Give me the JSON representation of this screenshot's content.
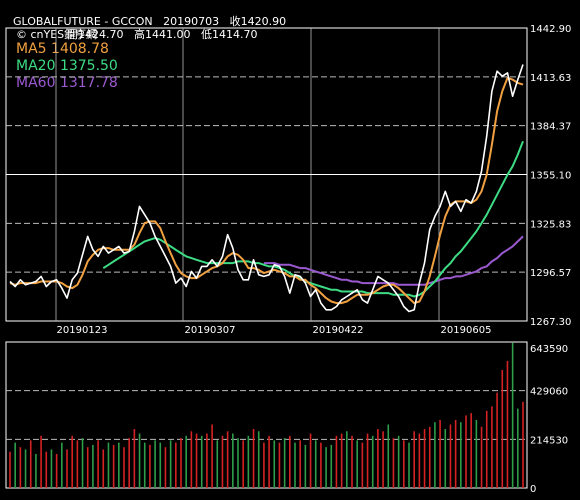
{
  "header": {
    "symbol": "GLOBALFUTURE - GCCON",
    "date": "20190703",
    "close_label": "收",
    "close": "1420.90",
    "open_label": "開",
    "open": "1424.70",
    "high_label": "高",
    "high": "1441.00",
    "low_label": "低",
    "low": "1414.70"
  },
  "watermark": "© cnYES鉅亨網",
  "legend": [
    {
      "name": "MA5",
      "value": "1408.78",
      "color": "#f0a040"
    },
    {
      "name": "MA20",
      "value": "1375.50",
      "color": "#3ddc84"
    },
    {
      "name": "MA60",
      "value": "1317.78",
      "color": "#9b59d0"
    }
  ],
  "colors": {
    "background": "#000000",
    "frame": "#ffffff",
    "grid": "#bbbbbb",
    "price": "#ffffff",
    "vol_up": "#d62222",
    "vol_down": "#2e9e4a"
  },
  "chart_data": [
    {
      "type": "line",
      "title": "",
      "x_tick_labels": [
        "20190123",
        "20190307",
        "20190422",
        "20190605"
      ],
      "y_tick_labels": [
        "1442.90",
        "1413.63",
        "1384.37",
        "1355.10",
        "1325.83",
        "1296.57",
        "1267.30"
      ],
      "ylim": [
        1267.3,
        1442.9
      ],
      "series": [
        {
          "name": "price",
          "values": [
            1291,
            1288,
            1292,
            1289,
            1290,
            1291,
            1294,
            1288,
            1291,
            1292,
            1287,
            1281,
            1292,
            1296,
            1307,
            1318,
            1310,
            1306,
            1312,
            1308,
            1310,
            1312,
            1308,
            1309,
            1321,
            1336,
            1331,
            1326,
            1318,
            1312,
            1306,
            1300,
            1290,
            1293,
            1288,
            1297,
            1293,
            1300,
            1300,
            1304,
            1300,
            1306,
            1319,
            1311,
            1298,
            1292,
            1292,
            1304,
            1295,
            1294,
            1295,
            1301,
            1300,
            1294,
            1284,
            1295,
            1294,
            1290,
            1282,
            1286,
            1278,
            1274,
            1274,
            1276,
            1280,
            1282,
            1284,
            1286,
            1280,
            1278,
            1286,
            1294,
            1292,
            1290,
            1286,
            1282,
            1276,
            1273,
            1274,
            1290,
            1302,
            1322,
            1330,
            1336,
            1345,
            1336,
            1339,
            1333,
            1340,
            1338,
            1345,
            1357,
            1378,
            1405,
            1417,
            1414,
            1416,
            1402,
            1412,
            1421
          ]
        },
        {
          "name": "MA5",
          "values": [
            1290,
            1289,
            1290,
            1290,
            1290,
            1290,
            1291,
            1291,
            1291,
            1291,
            1290,
            1288,
            1287,
            1289,
            1295,
            1303,
            1307,
            1310,
            1311,
            1311,
            1310,
            1310,
            1310,
            1310,
            1313,
            1320,
            1326,
            1327,
            1327,
            1323,
            1315,
            1308,
            1301,
            1296,
            1294,
            1293,
            1293,
            1295,
            1297,
            1299,
            1300,
            1302,
            1306,
            1308,
            1307,
            1304,
            1299,
            1299,
            1298,
            1296,
            1297,
            1298,
            1297,
            1296,
            1294,
            1294,
            1292,
            1292,
            1289,
            1287,
            1284,
            1281,
            1279,
            1278,
            1278,
            1279,
            1281,
            1283,
            1283,
            1283,
            1284,
            1286,
            1288,
            1289,
            1289,
            1287,
            1284,
            1281,
            1278,
            1279,
            1285,
            1294,
            1306,
            1319,
            1330,
            1337,
            1339,
            1339,
            1339,
            1338,
            1340,
            1345,
            1355,
            1373,
            1393,
            1405,
            1413,
            1412,
            1410,
            1409
          ]
        },
        {
          "name": "MA20",
          "values": [
            null,
            null,
            null,
            null,
            null,
            null,
            null,
            null,
            null,
            null,
            null,
            null,
            null,
            null,
            null,
            null,
            null,
            null,
            1299,
            1301,
            1303,
            1305,
            1307,
            1309,
            1311,
            1313,
            1315,
            1316,
            1317,
            1316,
            1314,
            1312,
            1310,
            1308,
            1306,
            1305,
            1304,
            1303,
            1302,
            1302,
            1302,
            1302,
            1302,
            1302,
            1303,
            1303,
            1303,
            1302,
            1302,
            1301,
            1300,
            1300,
            1299,
            1298,
            1296,
            1294,
            1293,
            1291,
            1290,
            1289,
            1288,
            1287,
            1286,
            1286,
            1285,
            1285,
            1285,
            1285,
            1285,
            1284,
            1284,
            1284,
            1284,
            1284,
            1283,
            1283,
            1283,
            1283,
            1282,
            1283,
            1285,
            1288,
            1291,
            1295,
            1299,
            1302,
            1306,
            1309,
            1313,
            1317,
            1321,
            1326,
            1331,
            1337,
            1343,
            1349,
            1355,
            1360,
            1367,
            1375
          ]
        },
        {
          "name": "MA60",
          "values": [
            null,
            null,
            null,
            null,
            null,
            null,
            null,
            null,
            null,
            null,
            null,
            null,
            null,
            null,
            null,
            null,
            null,
            null,
            null,
            null,
            null,
            null,
            null,
            null,
            null,
            null,
            null,
            null,
            null,
            null,
            null,
            null,
            null,
            null,
            null,
            null,
            null,
            null,
            null,
            null,
            null,
            null,
            null,
            null,
            null,
            null,
            null,
            null,
            null,
            1302,
            1302,
            1302,
            1301,
            1301,
            1301,
            1300,
            1299,
            1299,
            1298,
            1297,
            1296,
            1295,
            1294,
            1293,
            1292,
            1292,
            1291,
            1291,
            1290,
            1290,
            1290,
            1290,
            1290,
            1290,
            1290,
            1289,
            1289,
            1289,
            1289,
            1289,
            1289,
            1290,
            1291,
            1292,
            1293,
            1293,
            1294,
            1294,
            1295,
            1296,
            1297,
            1299,
            1300,
            1303,
            1305,
            1308,
            1310,
            1312,
            1315,
            1318
          ]
        }
      ]
    },
    {
      "type": "bar",
      "title": "",
      "y_tick_labels": [
        "643590",
        "429060",
        "214530",
        "0"
      ],
      "ylim": [
        0,
        643590
      ],
      "values": [
        160000,
        200000,
        180000,
        170000,
        210000,
        150000,
        230000,
        160000,
        170000,
        150000,
        200000,
        170000,
        230000,
        210000,
        220000,
        180000,
        190000,
        210000,
        170000,
        200000,
        190000,
        200000,
        180000,
        220000,
        260000,
        240000,
        200000,
        190000,
        210000,
        200000,
        180000,
        210000,
        200000,
        220000,
        230000,
        250000,
        240000,
        230000,
        240000,
        280000,
        210000,
        230000,
        250000,
        240000,
        220000,
        210000,
        230000,
        260000,
        250000,
        200000,
        230000,
        210000,
        200000,
        220000,
        230000,
        200000,
        210000,
        190000,
        240000,
        210000,
        200000,
        180000,
        190000,
        230000,
        240000,
        250000,
        230000,
        210000,
        200000,
        240000,
        230000,
        260000,
        250000,
        280000,
        220000,
        230000,
        210000,
        200000,
        250000,
        240000,
        260000,
        270000,
        290000,
        300000,
        260000,
        280000,
        300000,
        290000,
        320000,
        330000,
        300000,
        270000,
        340000,
        360000,
        420000,
        520000,
        560000,
        640000,
        350000,
        380000
      ],
      "directions": [
        "u",
        "d",
        "u",
        "d",
        "u",
        "d",
        "u",
        "u",
        "d",
        "u",
        "d",
        "u",
        "u",
        "u",
        "d",
        "u",
        "d",
        "u",
        "u",
        "d",
        "u",
        "d",
        "u",
        "u",
        "u",
        "d",
        "d",
        "u",
        "d",
        "d",
        "u",
        "d",
        "u",
        "u",
        "d",
        "u",
        "u",
        "d",
        "u",
        "u",
        "d",
        "u",
        "u",
        "d",
        "d",
        "u",
        "d",
        "u",
        "d",
        "u",
        "u",
        "d",
        "u",
        "d",
        "u",
        "d",
        "u",
        "d",
        "u",
        "d",
        "u",
        "d",
        "d",
        "u",
        "u",
        "d",
        "u",
        "d",
        "u",
        "u",
        "d",
        "u",
        "u",
        "d",
        "u",
        "d",
        "u",
        "d",
        "u",
        "u",
        "u",
        "u",
        "d",
        "u",
        "d",
        "u",
        "u",
        "d",
        "u",
        "u",
        "d",
        "u",
        "u",
        "u",
        "u",
        "u",
        "u",
        "d",
        "d",
        "u"
      ]
    }
  ]
}
